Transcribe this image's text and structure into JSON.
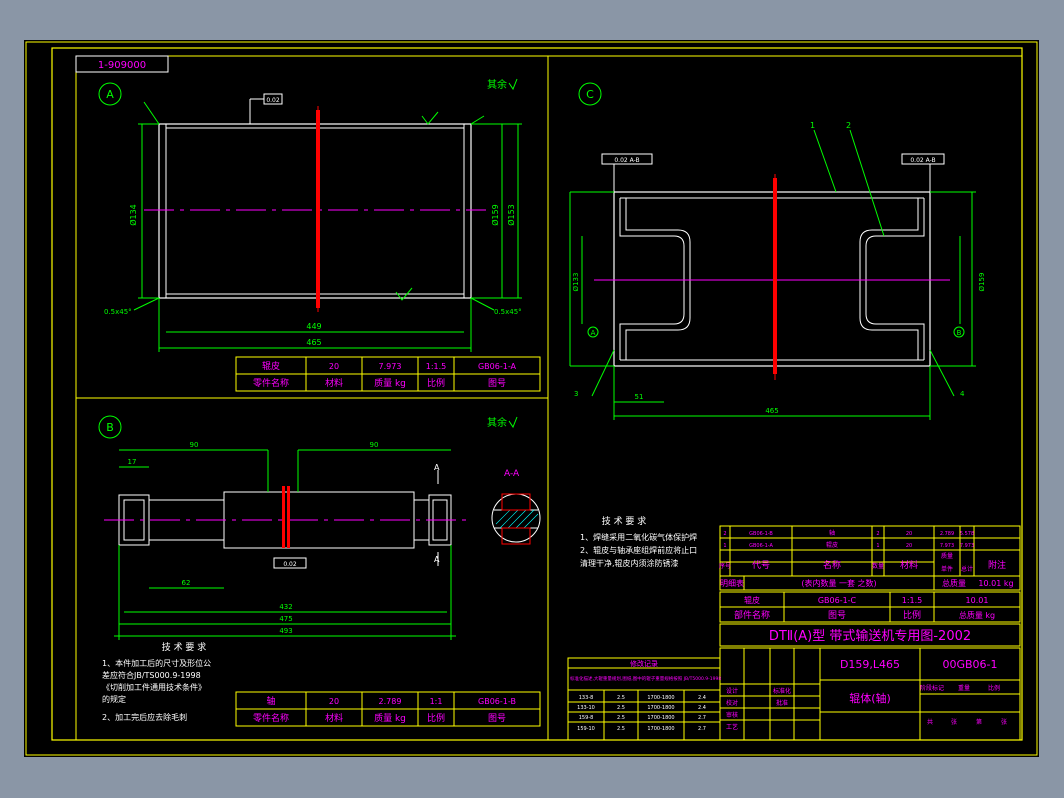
{
  "drawing_number_tag": "1-909000",
  "view_labels": {
    "a": "A",
    "b": "B",
    "c": "C"
  },
  "roughness_rest_a": "其余",
  "roughness_rest_b": "其余",
  "view_a": {
    "dim_bottom_inner": "449",
    "dim_bottom_total": "465",
    "dim_left_dia": "Ø134",
    "dim_right_dia": "Ø159",
    "dim_right_outer": "Ø153",
    "callout_left": "0.5x45°",
    "callout_right": "0.5x45°",
    "tol_box": "0.02"
  },
  "view_b": {
    "dim_top_left": "17",
    "dim_top_mid": "90",
    "dim_top_right": "90",
    "dim_bottom_1": "62",
    "dim_bottom_2": "432",
    "dim_bottom_3": "475",
    "dim_bottom_4": "493",
    "section_mark": "A",
    "section_title": "A-A",
    "center_box": "0.02"
  },
  "view_c": {
    "callout_1": "1",
    "callout_2": "2",
    "dim_bottom_1": "51",
    "dim_bottom_2": "465",
    "dim_left": "Ø133",
    "dim_right": "Ø159",
    "tol_left": "0.02 A-B",
    "tol_right": "0.02 A-B",
    "datum_a": "A",
    "datum_b": "B",
    "weld_left": "3",
    "weld_right": "4"
  },
  "title_block_a": {
    "row1": [
      "辊皮",
      "20",
      "7.973",
      "1:1.5",
      "GB06-1-A"
    ],
    "row2": [
      "零件名称",
      "材料",
      "质量 kg",
      "比例",
      "图号"
    ]
  },
  "title_block_b": {
    "row1": [
      "轴",
      "20",
      "2.789",
      "1:1",
      "GB06-1-B"
    ],
    "row2": [
      "零件名称",
      "材料",
      "质量 kg",
      "比例",
      "图号"
    ]
  },
  "tech_req_b": {
    "title": "技 术 要 求",
    "lines": [
      "1、本件加工后的尺寸及形位公",
      "   差应符合JB/TS000.9-1998",
      "   《切削加工件通用技术条件》",
      "   的规定",
      "2、加工完后应去除毛刺"
    ]
  },
  "tech_req_c": {
    "title": "技 术 要 求",
    "lines": [
      "1、焊缝采用二氧化碳气体保护焊",
      "2、辊皮与轴承座组焊前应将止口",
      "   清理干净,辊皮内须涂防锈漆"
    ]
  },
  "parts_list": {
    "rows": [
      [
        "2",
        "GB06-1-B",
        "轴",
        "2",
        "20",
        "",
        "2.789",
        "5.578",
        ""
      ],
      [
        "1",
        "GB06-1-A",
        "辊皮",
        "1",
        "20",
        "",
        "7.973",
        "7.973",
        ""
      ]
    ],
    "header": [
      "序号",
      "代号",
      "名称",
      "数量",
      "材料",
      "",
      "单件",
      "总计",
      "附注"
    ],
    "mass_label": "质量",
    "detail_row": [
      "明细表",
      "(表内数量 一套 之数)",
      "总质量",
      "10.01 kg"
    ],
    "part_row": [
      "辊皮",
      "GB06-1-C",
      "1:1.5",
      "10.01"
    ],
    "part_row_labels": [
      "部件名称",
      "图号",
      "比例",
      "总质量 kg"
    ]
  },
  "main_title": "DTⅡ(A)型 带式输送机专用图-2002",
  "spec": "D159,L465",
  "drawing_code": "00GB06-1",
  "drawing_name": "辊体(轴)",
  "design_rows": [
    "设计",
    "校对",
    "审核",
    "工艺",
    "标准化",
    "批准"
  ],
  "stage_labels": [
    "阶段标记",
    "重量",
    "比例"
  ],
  "sheet_labels": [
    "共",
    "张",
    "第",
    "张"
  ],
  "revision_block": {
    "title": "修改记录",
    "text": "标准化描述,大辊重量规划,图纸,图中的辊子重量规格按照 JB/T5000.9-1998",
    "rows": [
      [
        "133-8",
        "2.5",
        "1700-1800",
        "2.4"
      ],
      [
        "133-10",
        "2.5",
        "1700-1800",
        "2.4"
      ],
      [
        "159-8",
        "2.5",
        "1700-1800",
        "2.7"
      ],
      [
        "159-10",
        "2.5",
        "1700-1800",
        "2.7"
      ]
    ]
  },
  "colors": {
    "frame": "#ffff00",
    "lines": "#ffffff",
    "dims": "#00ff00",
    "text": "#ff00ff",
    "section": "#ff0000",
    "hatch": "#00ffff"
  }
}
